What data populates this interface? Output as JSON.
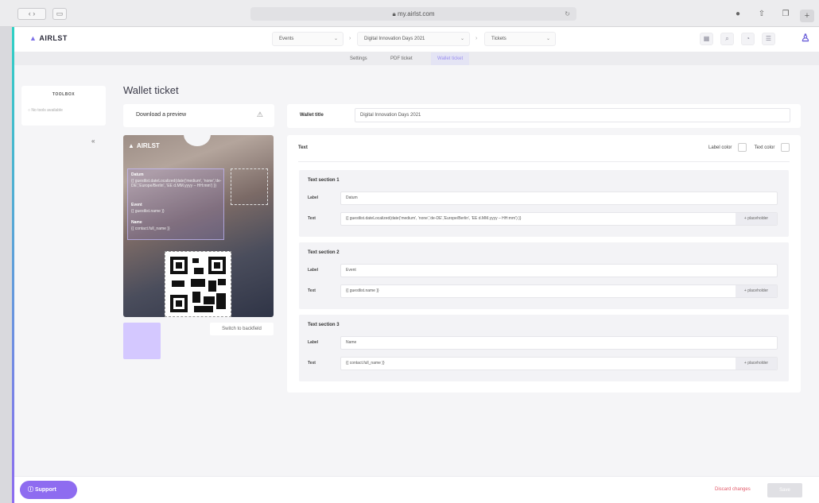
{
  "browser": {
    "url": "my.airlst.com"
  },
  "app": {
    "logo_text": "AIRLST",
    "breadcrumb": {
      "events": "Events",
      "event": "Digital Innovation Days 2021",
      "tickets": "Tickets"
    },
    "tabs": [
      "Settings",
      "PDF ticket",
      "Wallet ticket"
    ],
    "active_tab": 2
  },
  "toolbox": {
    "title": "TOOLBOX",
    "empty_text": "No tools available",
    "collapse_glyph": "«"
  },
  "page": {
    "title": "Wallet ticket"
  },
  "preview": {
    "download_label": "Download a preview",
    "ticket": {
      "logo_text": "AIRLST",
      "field1_label": "Datum",
      "field1_value": "{{ guestlist.dateLocalized(date('medium', 'none','de-DE','Europe/Berlin', 'EE d.MM.yyyy – HH:mm') }}",
      "field2_label": "Event",
      "field2_value": "{{ guestlist.name }}",
      "field3_label": "Name",
      "field3_value": "{{ contact.full_name }}"
    },
    "switch_label": "Switch to backfield"
  },
  "wallet_title": {
    "label": "Wallet title",
    "value": "Digital Innovation Days 2021"
  },
  "text_panel": {
    "heading": "Text",
    "label_color": "Label color",
    "text_color": "Text color",
    "row_label": "Label",
    "row_text": "Text",
    "placeholder_btn": "+ placeholder",
    "sections": [
      {
        "title": "Text section 1",
        "label_value": "Datum",
        "text_value": "{{ guestlist.dateLocalized(date('medium', 'none','de-DE','Europe/Berlin', 'EE d.MM.yyyy – HH:mm') }}"
      },
      {
        "title": "Text section 2",
        "label_value": "Event",
        "text_value": "{{ guestlist.name }}"
      },
      {
        "title": "Text section 3",
        "label_value": "Name",
        "text_value": "{{ contact.full_name }}"
      }
    ]
  },
  "footer": {
    "support_label": "Support",
    "discard_label": "Discard changes",
    "save_label": "Save"
  },
  "colors": {
    "accent": "#8e6cf0",
    "teal": "#2ed1c4",
    "danger": "#e35a6a"
  }
}
